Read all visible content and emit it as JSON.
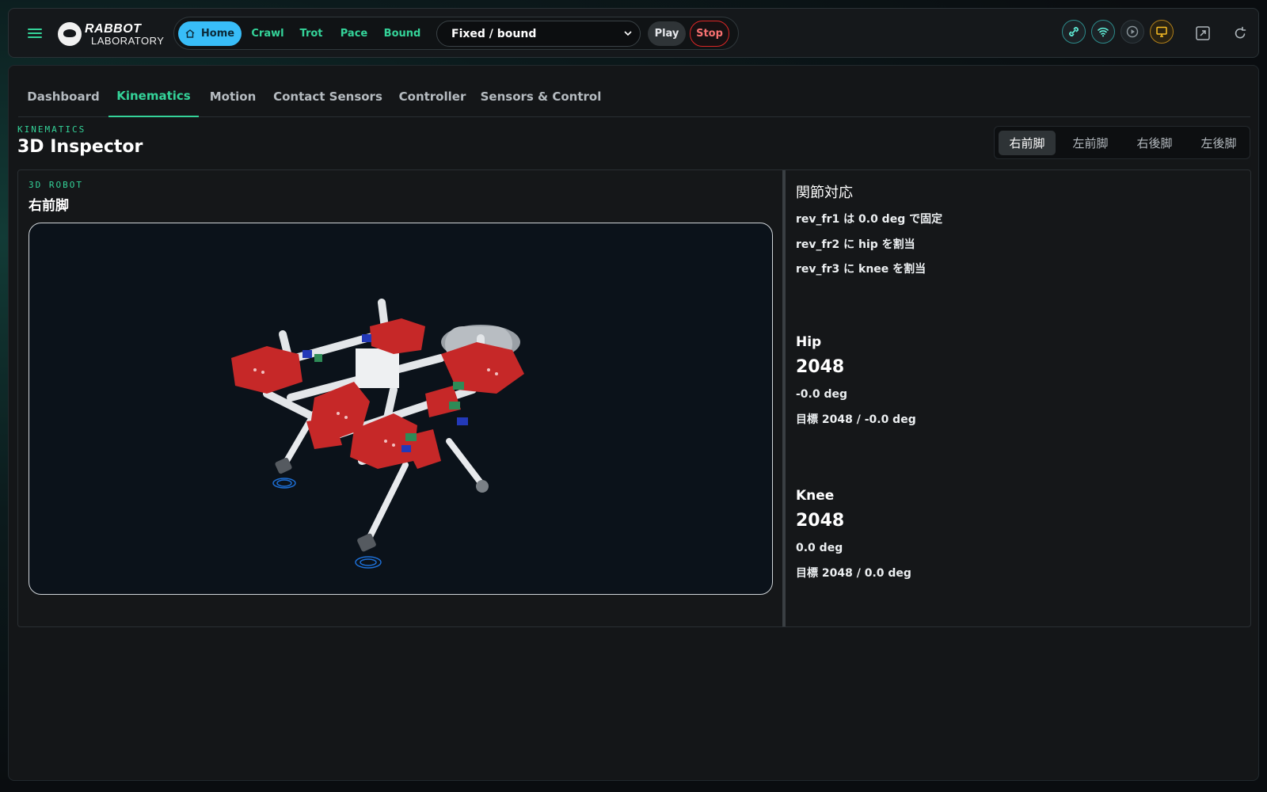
{
  "header": {
    "logo_line1": "RABBOT",
    "logo_line2": "LABORATORY",
    "home_label": "Home",
    "gaits": [
      "Crawl",
      "Trot",
      "Pace",
      "Bound"
    ],
    "mode_select_value": "Fixed / bound",
    "play_label": "Play",
    "stop_label": "Stop",
    "status_icons": [
      "link-icon",
      "wifi-icon",
      "play-circle-icon",
      "monitor-icon"
    ],
    "tool_icons": [
      "expand-icon",
      "refresh-icon"
    ]
  },
  "tabs": [
    {
      "label": "Dashboard",
      "active": false
    },
    {
      "label": "Kinematics",
      "active": true
    },
    {
      "label": "Motion",
      "active": false
    },
    {
      "label": "Contact Sensors",
      "active": false
    },
    {
      "label": "Controller",
      "active": false
    },
    {
      "label": "Sensors & Control",
      "active": false
    }
  ],
  "section": {
    "eyebrow": "KINEMATICS",
    "title": "3D Inspector"
  },
  "legs": [
    {
      "label": "右前脚",
      "active": true
    },
    {
      "label": "左前脚",
      "active": false
    },
    {
      "label": "右後脚",
      "active": false
    },
    {
      "label": "左後脚",
      "active": false
    }
  ],
  "robot": {
    "eyebrow": "3D ROBOT",
    "leg_title": "右前脚"
  },
  "joints": {
    "title": "関節対応",
    "mapping": [
      "rev_fr1 は 0.0 deg で固定",
      "rev_fr2 に hip を割当",
      "rev_fr3 に knee を割当"
    ],
    "hip": {
      "label": "Hip",
      "value": "2048",
      "deg": "-0.0 deg",
      "target": "目標 2048 / -0.0 deg"
    },
    "knee": {
      "label": "Knee",
      "value": "2048",
      "deg": "0.0 deg",
      "target": "目標 2048 / 0.0 deg"
    }
  },
  "colors": {
    "accent": "#34d399",
    "home": "#38bdf8",
    "stop": "#dc2626",
    "robot_red": "#c62828"
  }
}
